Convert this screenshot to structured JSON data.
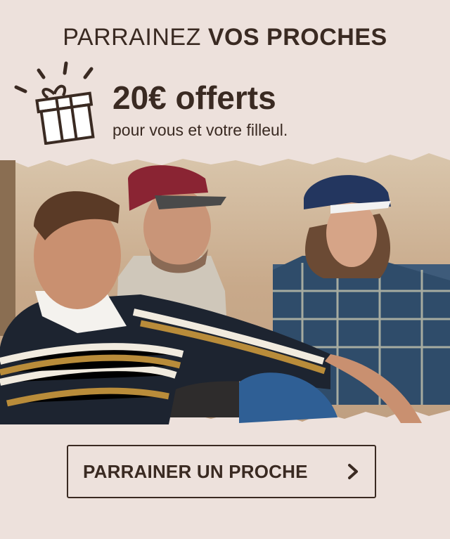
{
  "header": {
    "title_light": "PARRAINEZ",
    "title_bold": "VOS PROCHES"
  },
  "offer": {
    "amount": "20€ offerts",
    "subtitle": "pour vous et votre filleul.",
    "icon": "gift-icon"
  },
  "photo": {
    "description": "three-people-sitting-outdoors"
  },
  "cta": {
    "label": "PARRAINER UN PROCHE",
    "icon": "chevron-right-icon"
  },
  "colors": {
    "background": "#ede1dc",
    "text": "#3a2a22"
  }
}
